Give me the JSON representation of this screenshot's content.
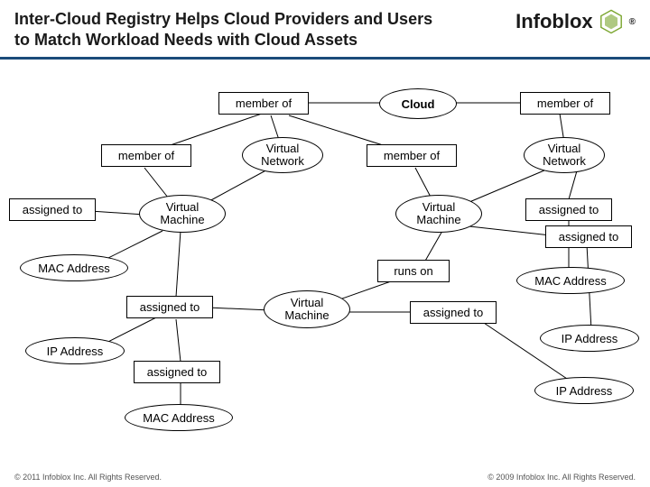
{
  "header": {
    "title": "Inter-Cloud Registry Helps Cloud Providers and Users to Match Workload Needs with Cloud Assets",
    "logo_text": "Infoblox"
  },
  "nodes": {
    "cloud": "Cloud",
    "member_of_top": "member of",
    "member_of_tr": "member of",
    "member_of_left": "member of",
    "member_of_mid": "member of",
    "vnet_left": "Virtual Network",
    "vnet_right": "Virtual Network",
    "vm_left": "Virtual Machine",
    "vm_right": "Virtual Machine",
    "vm_bottom": "Virtual Machine",
    "assigned_tl": "assigned to",
    "assigned_r1": "assigned to",
    "assigned_r2": "assigned to",
    "assigned_bl": "assigned to",
    "assigned_bl2": "assigned to",
    "assigned_mid": "assigned to",
    "runs_on": "runs on",
    "mac_tl": "MAC Address",
    "mac_r": "MAC Address",
    "mac_b": "MAC Address",
    "ip_l": "IP Address",
    "ip_r1": "IP Address",
    "ip_r2": "IP Address"
  },
  "footer": {
    "left": "© 2011 Infoblox Inc. All Rights Reserved.",
    "right": "© 2009 Infoblox Inc. All Rights Reserved."
  }
}
